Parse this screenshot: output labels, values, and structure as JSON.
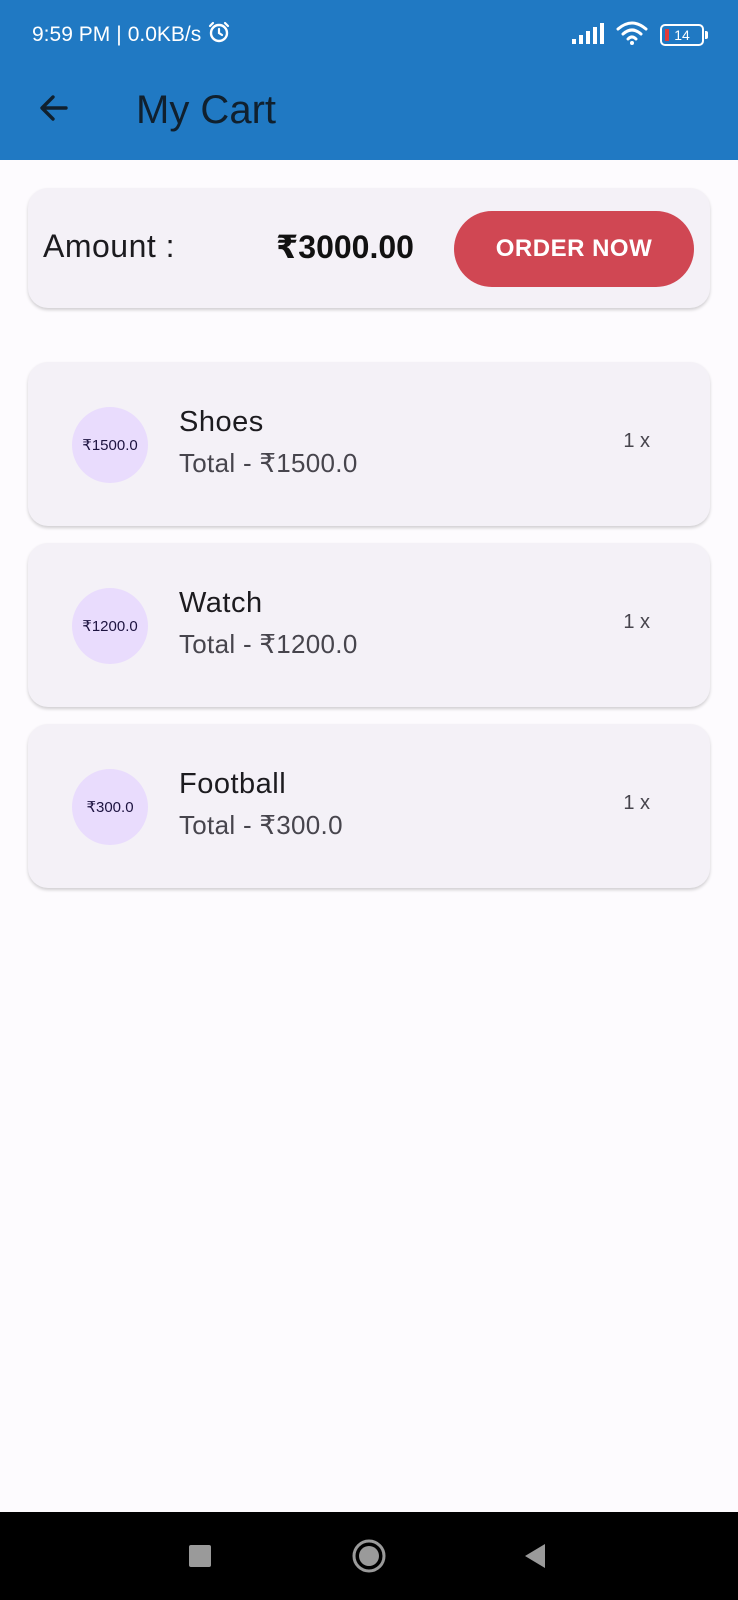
{
  "status_bar": {
    "time": "9:59 PM",
    "network_speed": "0.0KB/s",
    "battery_level": "14",
    "icons": [
      "alarm-icon",
      "signal-icon",
      "wifi-icon",
      "battery-icon"
    ]
  },
  "app_bar": {
    "title": "My Cart",
    "back_icon": "arrow-left-icon",
    "background": "#2079c3"
  },
  "summary": {
    "amount_label": "Amount  :",
    "amount_value": "₹3000.00",
    "order_button": "ORDER NOW",
    "order_button_color": "#d04753"
  },
  "cart": {
    "items": [
      {
        "avatar": "₹1500.0",
        "name": "Shoes",
        "total": "Total -  ₹1500.0",
        "quantity": "1 x"
      },
      {
        "avatar": "₹1200.0",
        "name": "Watch",
        "total": "Total -  ₹1200.0",
        "quantity": "1 x"
      },
      {
        "avatar": "₹300.0",
        "name": "Football",
        "total": "Total -  ₹300.0",
        "quantity": "1 x"
      }
    ]
  },
  "nav_bar": {
    "icons": [
      "recents-square-icon",
      "home-circle-icon",
      "back-triangle-icon"
    ]
  }
}
